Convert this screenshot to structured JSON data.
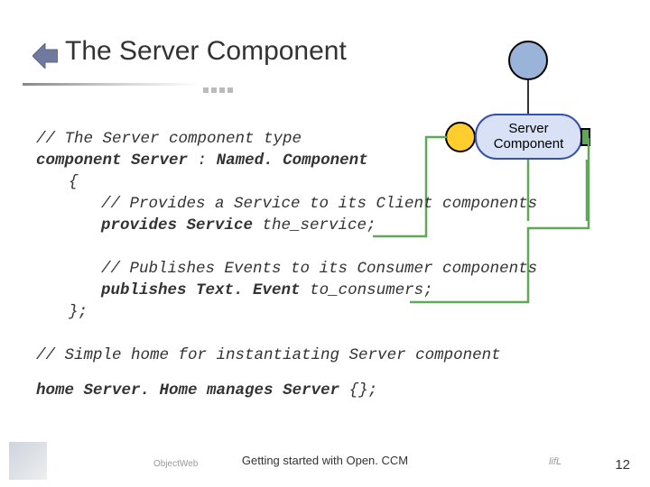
{
  "title": "The Server Component",
  "diagram": {
    "label": "Server\nComponent"
  },
  "code": {
    "c1": "// The Server component type",
    "l2_kw": "component ",
    "l2_name": "Server",
    "l2_mid": " : ",
    "l2_parent": "Named. Component",
    "l3": "{",
    "c4": "// Provides a Service to its Client components",
    "l5_kw": "provides ",
    "l5_tp": "Service",
    "l5_rest": " the_service;",
    "c7": "// Publishes Events to its Consumer components",
    "l8_kw": "publishes ",
    "l8_tp": "Text. Event",
    "l8_rest": " to_consumers;",
    "l9": "};",
    "c10": "// Simple home for instantiating Server component",
    "l11_kw1": "home ",
    "l11_name": "Server. Home",
    "l11_kw2": " manages ",
    "l11_tp": "Server",
    "l11_rest": " {};"
  },
  "footer": {
    "text": "Getting started with Open. CCM",
    "page": "12"
  }
}
